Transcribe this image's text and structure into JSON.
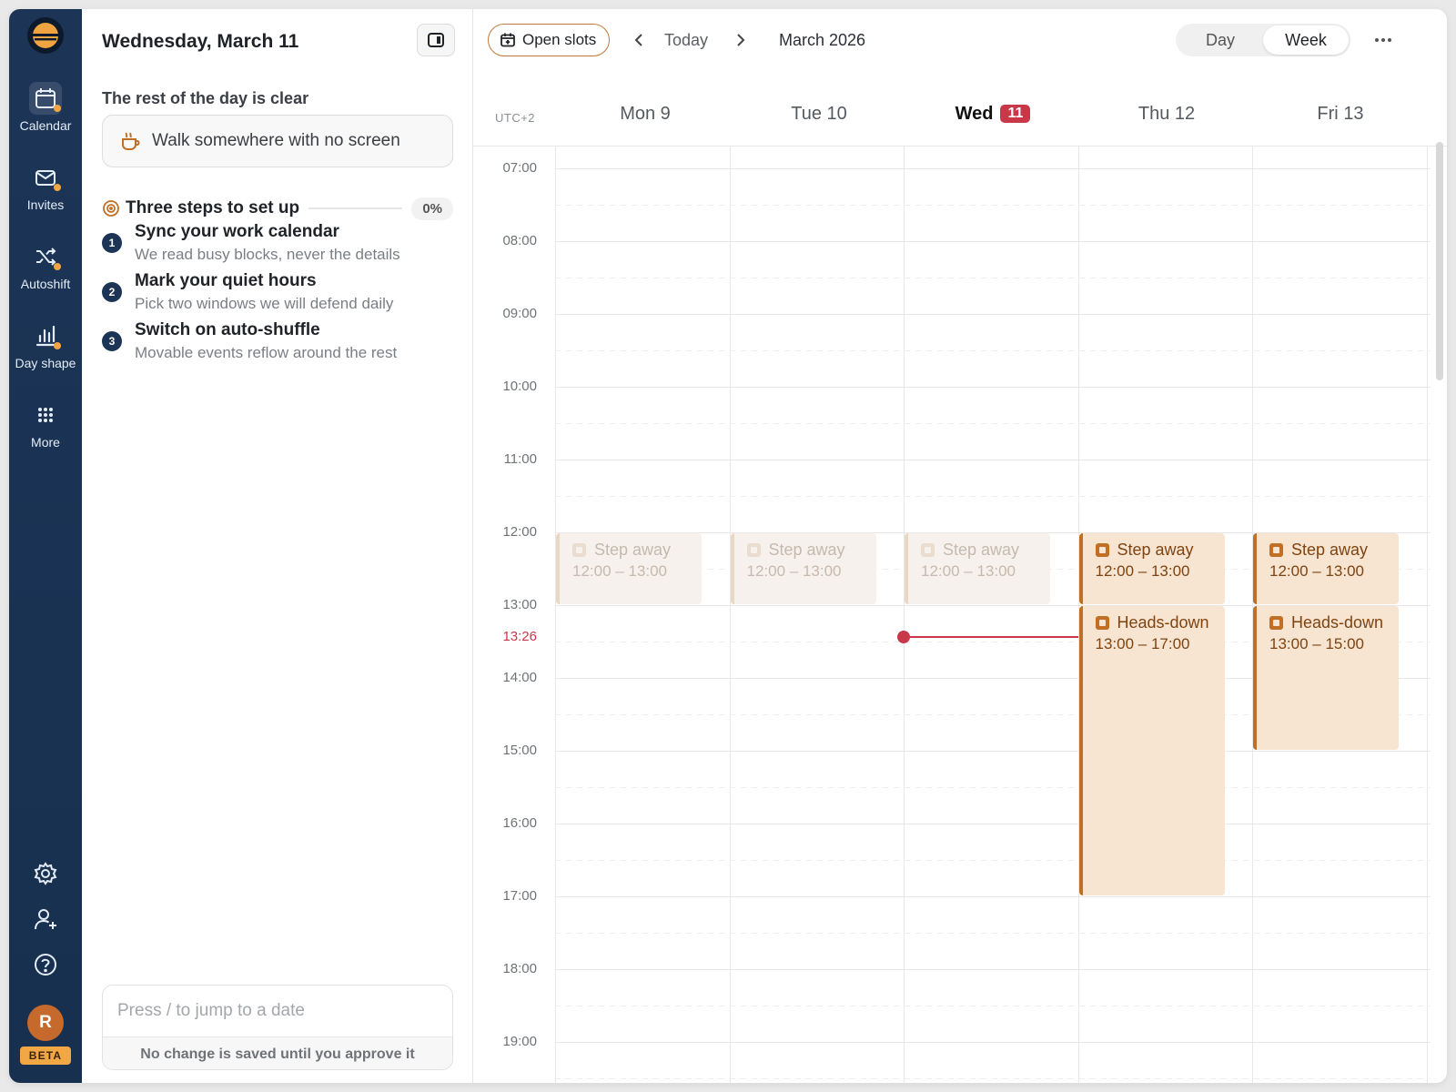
{
  "rail": {
    "items": [
      {
        "label": "Calendar",
        "icon": "calendar-icon",
        "active": true,
        "dot": true
      },
      {
        "label": "Invites",
        "icon": "mail-icon",
        "active": false,
        "dot": true
      },
      {
        "label": "Autoshift",
        "icon": "shuffle-icon",
        "active": false,
        "dot": true
      },
      {
        "label": "Day shape",
        "icon": "bar-chart-icon",
        "active": false,
        "dot": true
      },
      {
        "label": "More",
        "icon": "grid-icon",
        "active": false,
        "dot": false
      }
    ],
    "bottom_icons": [
      "gear-icon",
      "add-user-icon",
      "help-icon"
    ],
    "avatar_initial": "R",
    "beta_label": "BETA"
  },
  "panel": {
    "title": "Wednesday, March 11",
    "clear_text": "The rest of the day is clear",
    "suggestion": "Walk somewhere with no screen",
    "steps_title": "Three steps to set up",
    "steps_progress": "0%",
    "steps": [
      {
        "num": "1",
        "title": "Sync your work calendar",
        "subtitle": "We read busy blocks, never the details"
      },
      {
        "num": "2",
        "title": "Mark your quiet hours",
        "subtitle": "Pick two windows we will defend daily"
      },
      {
        "num": "3",
        "title": "Switch on auto-shuffle",
        "subtitle": "Movable events reflow around the rest"
      }
    ],
    "jump_placeholder": "Press / to jump to a date",
    "jump_footer": "No change is saved until you approve it"
  },
  "toolbar": {
    "open_slots_label": "Open slots",
    "today_label": "Today",
    "month_label": "March 2026",
    "view_options": [
      "Day",
      "Week"
    ],
    "selected_view": "Week"
  },
  "calendar": {
    "timezone": "UTC+2",
    "days": [
      {
        "name": "Mon",
        "num": "9",
        "today": false
      },
      {
        "name": "Tue",
        "num": "10",
        "today": false
      },
      {
        "name": "Wed",
        "num": "11",
        "today": true
      },
      {
        "name": "Thu",
        "num": "12",
        "today": false
      },
      {
        "name": "Fri",
        "num": "13",
        "today": false
      }
    ],
    "hours": [
      "07:00",
      "08:00",
      "09:00",
      "10:00",
      "11:00",
      "12:00",
      "13:00",
      "14:00",
      "15:00",
      "16:00",
      "17:00",
      "18:00",
      "19:00"
    ],
    "now_time": "13:26",
    "now_day": 2,
    "events": [
      {
        "day": 0,
        "title": "Step away",
        "time": "12:00 – 13:00",
        "start": "12:00",
        "end": "13:00",
        "faded": true
      },
      {
        "day": 1,
        "title": "Step away",
        "time": "12:00 – 13:00",
        "start": "12:00",
        "end": "13:00",
        "faded": true
      },
      {
        "day": 2,
        "title": "Step away",
        "time": "12:00 – 13:00",
        "start": "12:00",
        "end": "13:00",
        "faded": true
      },
      {
        "day": 3,
        "title": "Step away",
        "time": "12:00 – 13:00",
        "start": "12:00",
        "end": "13:00",
        "faded": false
      },
      {
        "day": 4,
        "title": "Step away",
        "time": "12:00 – 13:00",
        "start": "12:00",
        "end": "13:00",
        "faded": false
      },
      {
        "day": 3,
        "title": "Heads-down",
        "time": "13:00 – 17:00",
        "start": "13:00",
        "end": "17:00",
        "faded": false
      },
      {
        "day": 4,
        "title": "Heads-down",
        "time": "13:00 – 15:00",
        "start": "13:00",
        "end": "15:00",
        "faded": false
      }
    ]
  },
  "colors": {
    "rail": "#1c3557",
    "accent": "#c06f24",
    "event_fill": "#f7e4d1",
    "now": "#c93848",
    "beta": "#f1a743"
  }
}
